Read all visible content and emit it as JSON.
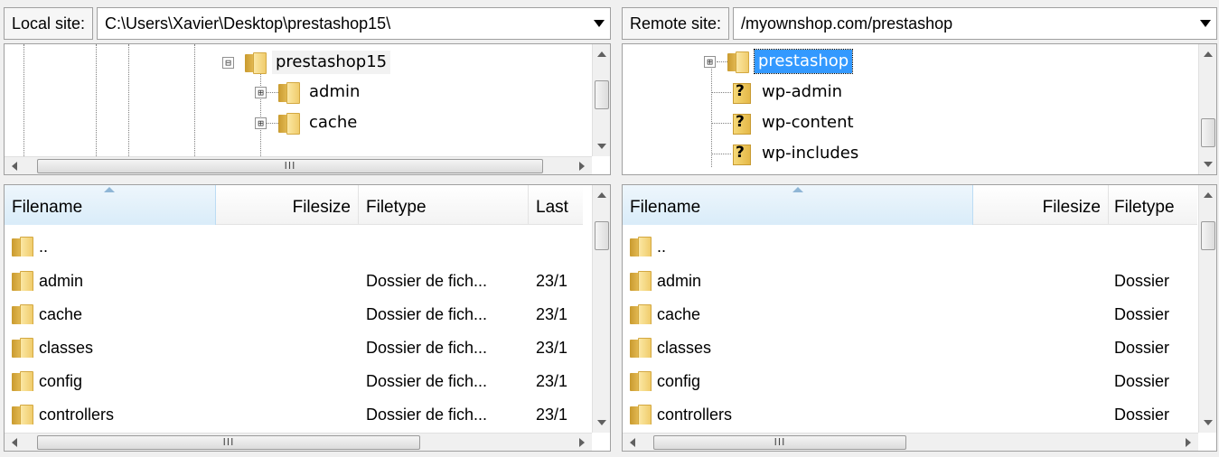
{
  "local": {
    "label": "Local site:",
    "path": "C:\\Users\\Xavier\\Desktop\\prestashop15\\",
    "tree": [
      {
        "label": "prestashop15",
        "expander": "⊟"
      },
      {
        "label": "admin",
        "expander": "⊞"
      },
      {
        "label": "cache",
        "expander": "⊞"
      }
    ],
    "columns": {
      "filename": "Filename",
      "filesize": "Filesize",
      "filetype": "Filetype",
      "last": "Last"
    },
    "files": [
      {
        "name": "..",
        "type": "",
        "date": ""
      },
      {
        "name": "admin",
        "type": "Dossier de fich...",
        "date": "23/1"
      },
      {
        "name": "cache",
        "type": "Dossier de fich...",
        "date": "23/1"
      },
      {
        "name": "classes",
        "type": "Dossier de fich...",
        "date": "23/1"
      },
      {
        "name": "config",
        "type": "Dossier de fich...",
        "date": "23/1"
      },
      {
        "name": "controllers",
        "type": "Dossier de fich...",
        "date": "23/1"
      }
    ]
  },
  "remote": {
    "label": "Remote site:",
    "path": "/myownshop.com/prestashop",
    "tree": [
      {
        "label": "prestashop",
        "expander": "⊞"
      },
      {
        "label": "wp-admin"
      },
      {
        "label": "wp-content"
      },
      {
        "label": "wp-includes"
      }
    ],
    "columns": {
      "filename": "Filename",
      "filesize": "Filesize",
      "filetype": "Filetype"
    },
    "files": [
      {
        "name": "..",
        "type": ""
      },
      {
        "name": "admin",
        "type": "Dossier"
      },
      {
        "name": "cache",
        "type": "Dossier"
      },
      {
        "name": "classes",
        "type": "Dossier"
      },
      {
        "name": "config",
        "type": "Dossier"
      },
      {
        "name": "controllers",
        "type": "Dossier"
      }
    ]
  },
  "icons": {
    "folder": "folder-icon",
    "unknown": "unknown-folder-icon",
    "hscroll_grip": "III"
  }
}
